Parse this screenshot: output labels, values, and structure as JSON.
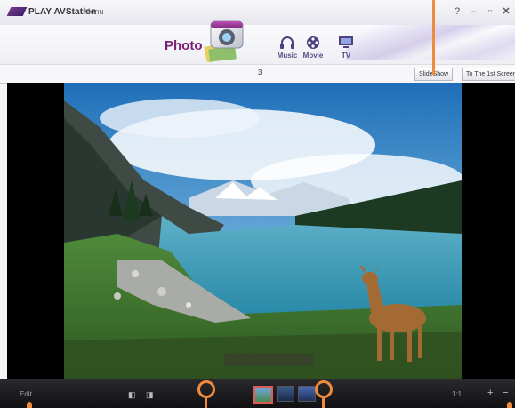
{
  "window": {
    "app_name": "PLAY AVStation",
    "menu_label": "Menu",
    "controls": {
      "help": "?",
      "minimize": "–",
      "restore": "▫",
      "close": "✕"
    }
  },
  "header": {
    "section_title": "Photo",
    "tabs": [
      {
        "label": "Music",
        "icon": "headphones-icon"
      },
      {
        "label": "Movie",
        "icon": "film-reel-icon"
      },
      {
        "label": "TV",
        "icon": "monitor-icon"
      }
    ]
  },
  "toolbar": {
    "page_number": "3",
    "slideshow_label": "SlideShow",
    "first_screen_label": "To The 1st Screen"
  },
  "bottom": {
    "left_label": "Edit",
    "zoom_minus": "−",
    "zoom_plus": "+",
    "zoom_mid": "1:1",
    "thumbnail_count": 3,
    "selected_thumbnail": 1
  },
  "colors": {
    "accent": "#7b1f73",
    "callout": "#f08a3c",
    "bottom_bar": "#1c1c20"
  }
}
